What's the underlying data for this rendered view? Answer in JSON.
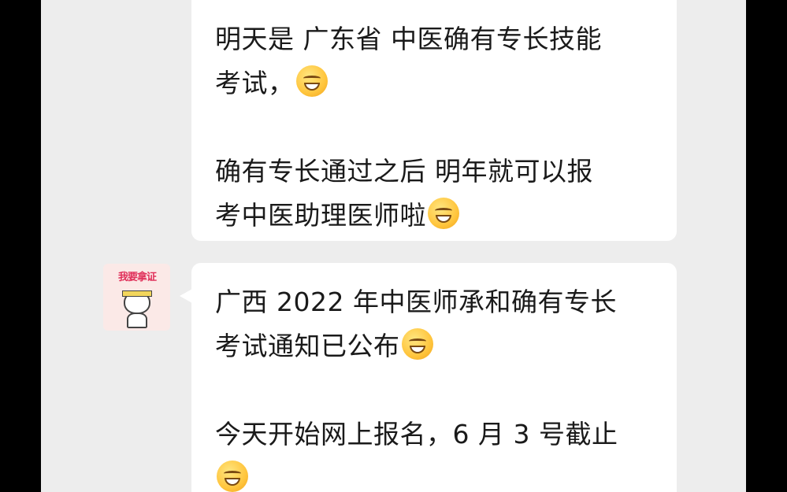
{
  "messages": [
    {
      "lines": [
        {
          "text": "明天是 广东省 中医确有专长技能",
          "emoji": ""
        },
        {
          "text": "考试，",
          "emoji": "smiling-emoji"
        },
        {
          "text": "",
          "emoji": ""
        },
        {
          "text": "确有专长通过之后  明年就可以报",
          "emoji": ""
        },
        {
          "text": "考中医助理医师啦",
          "emoji": "grinning-emoji"
        }
      ]
    },
    {
      "lines": [
        {
          "text": "广西 2022 年中医师承和确有专长",
          "emoji": ""
        },
        {
          "text": "考试通知已公布",
          "emoji": "blushing-emoji"
        },
        {
          "text": "",
          "emoji": ""
        },
        {
          "text": "今天开始网上报名，6 月 3 号截止",
          "emoji": ""
        },
        {
          "text": "",
          "emoji": "grinning-emoji"
        }
      ]
    }
  ],
  "avatar": {
    "text": "我要拿证"
  },
  "colors": {
    "background": "#ededed",
    "bubble": "#ffffff",
    "frame": "#000000"
  }
}
